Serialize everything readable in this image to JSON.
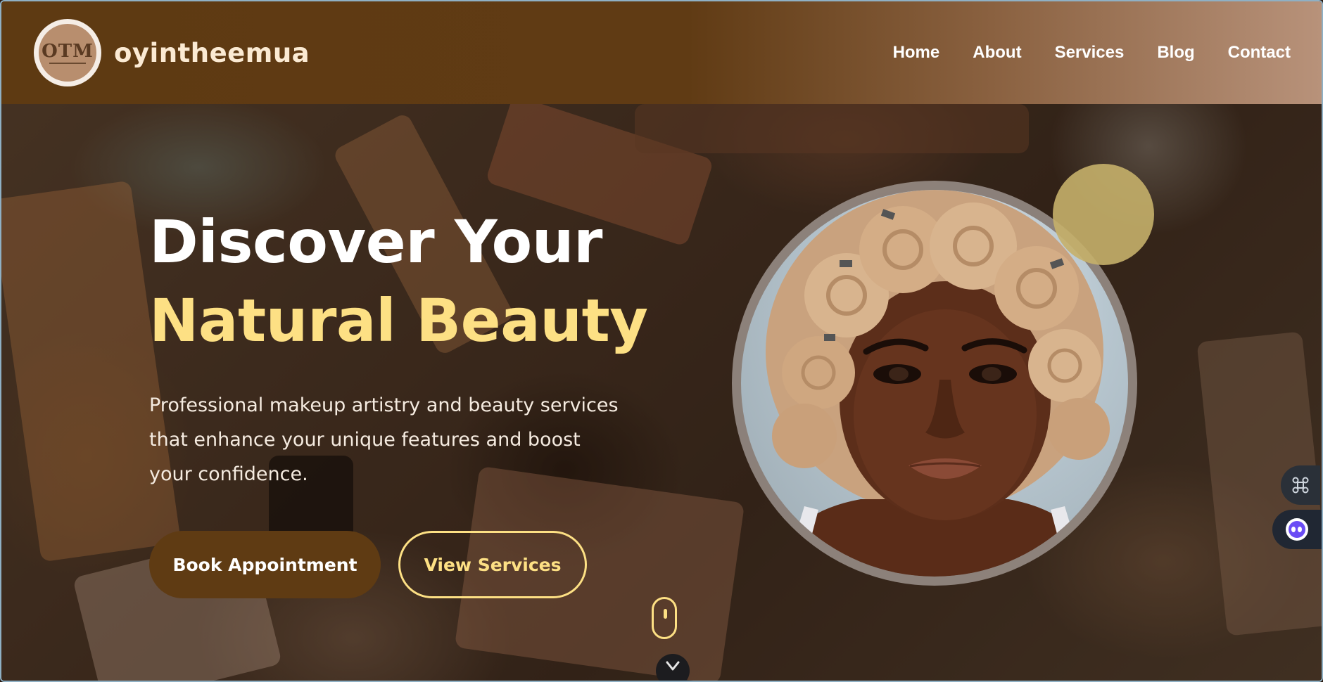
{
  "brand": {
    "name": "oyintheemua",
    "logo_mark": "OTM"
  },
  "nav": {
    "items": [
      "Home",
      "About",
      "Services",
      "Blog",
      "Contact"
    ]
  },
  "hero": {
    "title_line1": "Discover Your",
    "title_line2": "Natural Beauty",
    "description": "Professional makeup artistry and beauty services that enhance your unique features and boost your confidence.",
    "primary_button": "Book Appointment",
    "secondary_button": "View Services"
  },
  "colors": {
    "brand_brown": "#5f3b13",
    "accent_yellow": "#fde084",
    "nav_gradient_end": "#b8927a"
  },
  "icons": {
    "side_widget_1": "command-icon",
    "side_widget_2": "assistant-bot-icon",
    "scroll": "mouse-scroll-icon",
    "down": "chevron-down-icon"
  }
}
